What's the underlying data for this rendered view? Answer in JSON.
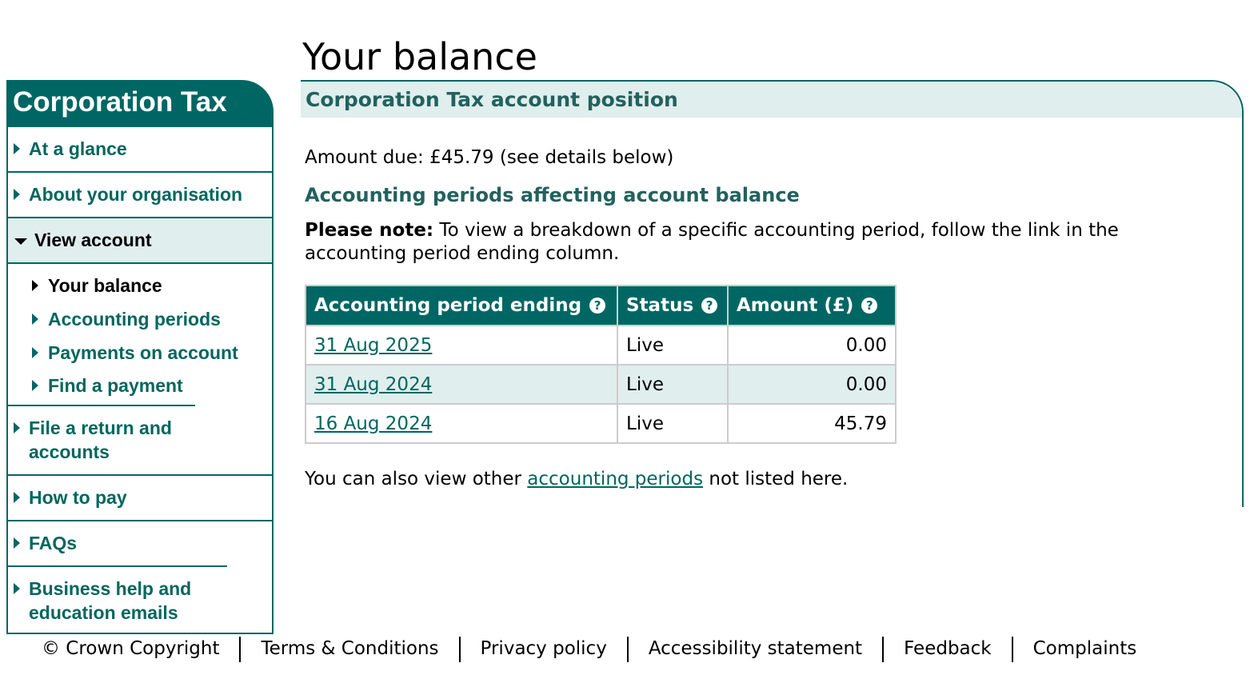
{
  "sidebar": {
    "title": "Corporation Tax",
    "items": [
      {
        "label": "At a glance"
      },
      {
        "label": "About your organisation"
      },
      {
        "label": "View account",
        "expanded": true,
        "children": [
          {
            "label": "Your balance",
            "current": true
          },
          {
            "label": "Accounting periods"
          },
          {
            "label": "Payments on account"
          },
          {
            "label": "Find a payment"
          }
        ]
      },
      {
        "label": "File a return and accounts"
      },
      {
        "label": "How to pay"
      },
      {
        "label": "FAQs"
      },
      {
        "label": "Business help and education emails"
      }
    ]
  },
  "page": {
    "title": "Your balance",
    "panel_title": "Corporation Tax account position",
    "amount_due": "Amount due: £45.79 (see details below)",
    "section_title": "Accounting periods affecting account balance",
    "note_label": "Please note:",
    "note_text": " To view a breakdown of a specific accounting period, follow the link in the accounting period ending column.",
    "table": {
      "headers": [
        "Accounting period ending",
        "Status",
        "Amount (£)"
      ],
      "help_icon": "?",
      "rows": [
        {
          "period": "31 Aug 2025",
          "status": "Live",
          "amount": "0.00"
        },
        {
          "period": "31 Aug 2024",
          "status": "Live",
          "amount": "0.00"
        },
        {
          "period": "16 Aug 2024",
          "status": "Live",
          "amount": "45.79"
        }
      ]
    },
    "also_pre": "You can also view other ",
    "also_link": "accounting periods",
    "also_post": " not listed here."
  },
  "footer": [
    "© Crown Copyright",
    "Terms & Conditions",
    "Privacy policy",
    "Accessibility statement",
    "Feedback",
    "Complaints"
  ],
  "colors": {
    "brand": "#006664",
    "light": "#e0eeed",
    "link": "#00665e"
  }
}
